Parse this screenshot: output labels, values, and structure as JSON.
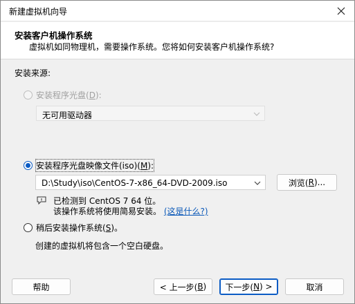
{
  "window": {
    "title": "新建虚拟机向导"
  },
  "header": {
    "title": "安装客户机操作系统",
    "subtitle": "虚拟机如同物理机，需要操作系统。您将如何安装客户机操作系统?"
  },
  "source_label": "安装来源:",
  "options": {
    "disc": {
      "label_pre": "安装程序光盘(",
      "key": "D",
      "label_post": "):",
      "drive_value": "无可用驱动器"
    },
    "iso": {
      "label_pre": "安装程序光盘映像文件(iso)(",
      "key": "M",
      "label_post": "):",
      "path_value": "D:\\Study\\iso\\CentOS-7-x86_64-DVD-2009.iso",
      "browse_pre": "浏览(",
      "browse_key": "R",
      "browse_post": ")...",
      "detect_line1": "已检测到 CentOS 7 64 位。",
      "detect_line2": "该操作系统将使用简易安装。",
      "help_link": "(这是什么?)"
    },
    "later": {
      "label_pre": "稍后安装操作系统(",
      "key": "S",
      "label_post": ")。",
      "description": "创建的虚拟机将包含一个空白硬盘。"
    }
  },
  "buttons": {
    "help": "帮助",
    "back_pre": "< 上一步(",
    "back_key": "B",
    "back_post": ")",
    "next_pre": "下一步(",
    "next_key": "N",
    "next_post": ") >",
    "cancel": "取消"
  },
  "colors": {
    "accent": "#0a5bc4",
    "link": "#0a58b8",
    "disabled_text": "#a0a0a0"
  }
}
